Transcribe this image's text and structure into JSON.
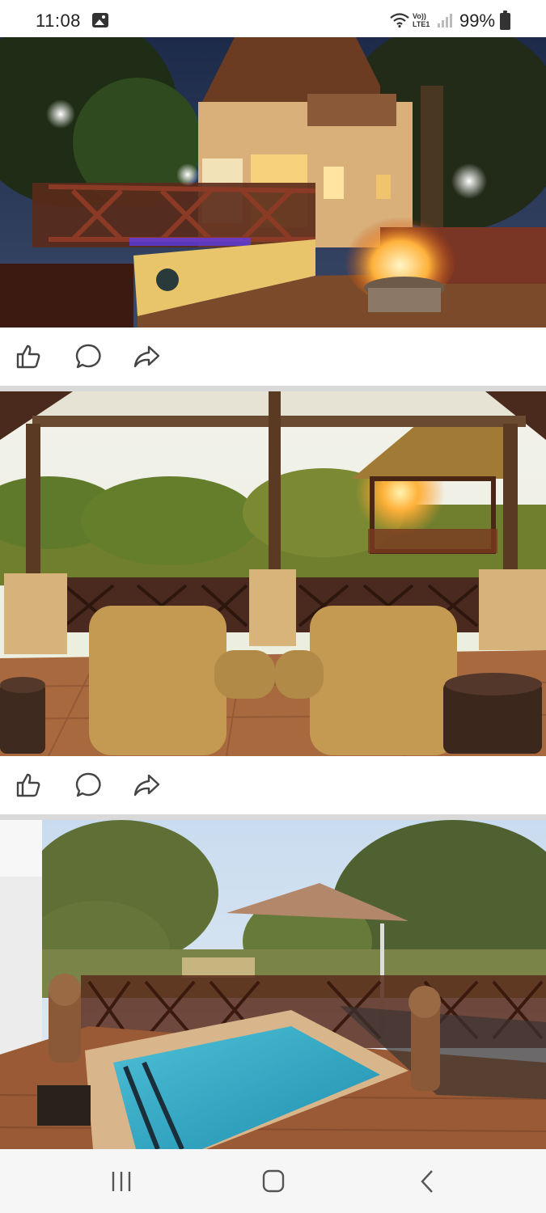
{
  "status_bar": {
    "time": "11:08",
    "volte_line1": "Vo))",
    "volte_line2": "LTE1",
    "battery": "99%",
    "icons": [
      "gallery-icon",
      "wifi-icon",
      "volte-icon",
      "signal-icon",
      "battery-icon"
    ]
  },
  "feed": {
    "posts": [
      {
        "photo": "lodge-night-fire-pit-photo",
        "actions": [
          "like-icon",
          "comment-icon",
          "share-icon"
        ]
      },
      {
        "photo": "deck-sunset-chairs-photo",
        "actions": [
          "like-icon",
          "comment-icon",
          "share-icon"
        ]
      },
      {
        "photo": "plunge-pool-umbrella-photo",
        "actions": []
      }
    ]
  },
  "nav_bar": {
    "buttons": [
      "recent-apps-icon",
      "home-icon",
      "back-icon"
    ]
  },
  "colors": {
    "background": "#ffffff",
    "divider": "#d9d9d9",
    "icon": "#444444",
    "nav_background": "#f6f6f6"
  }
}
